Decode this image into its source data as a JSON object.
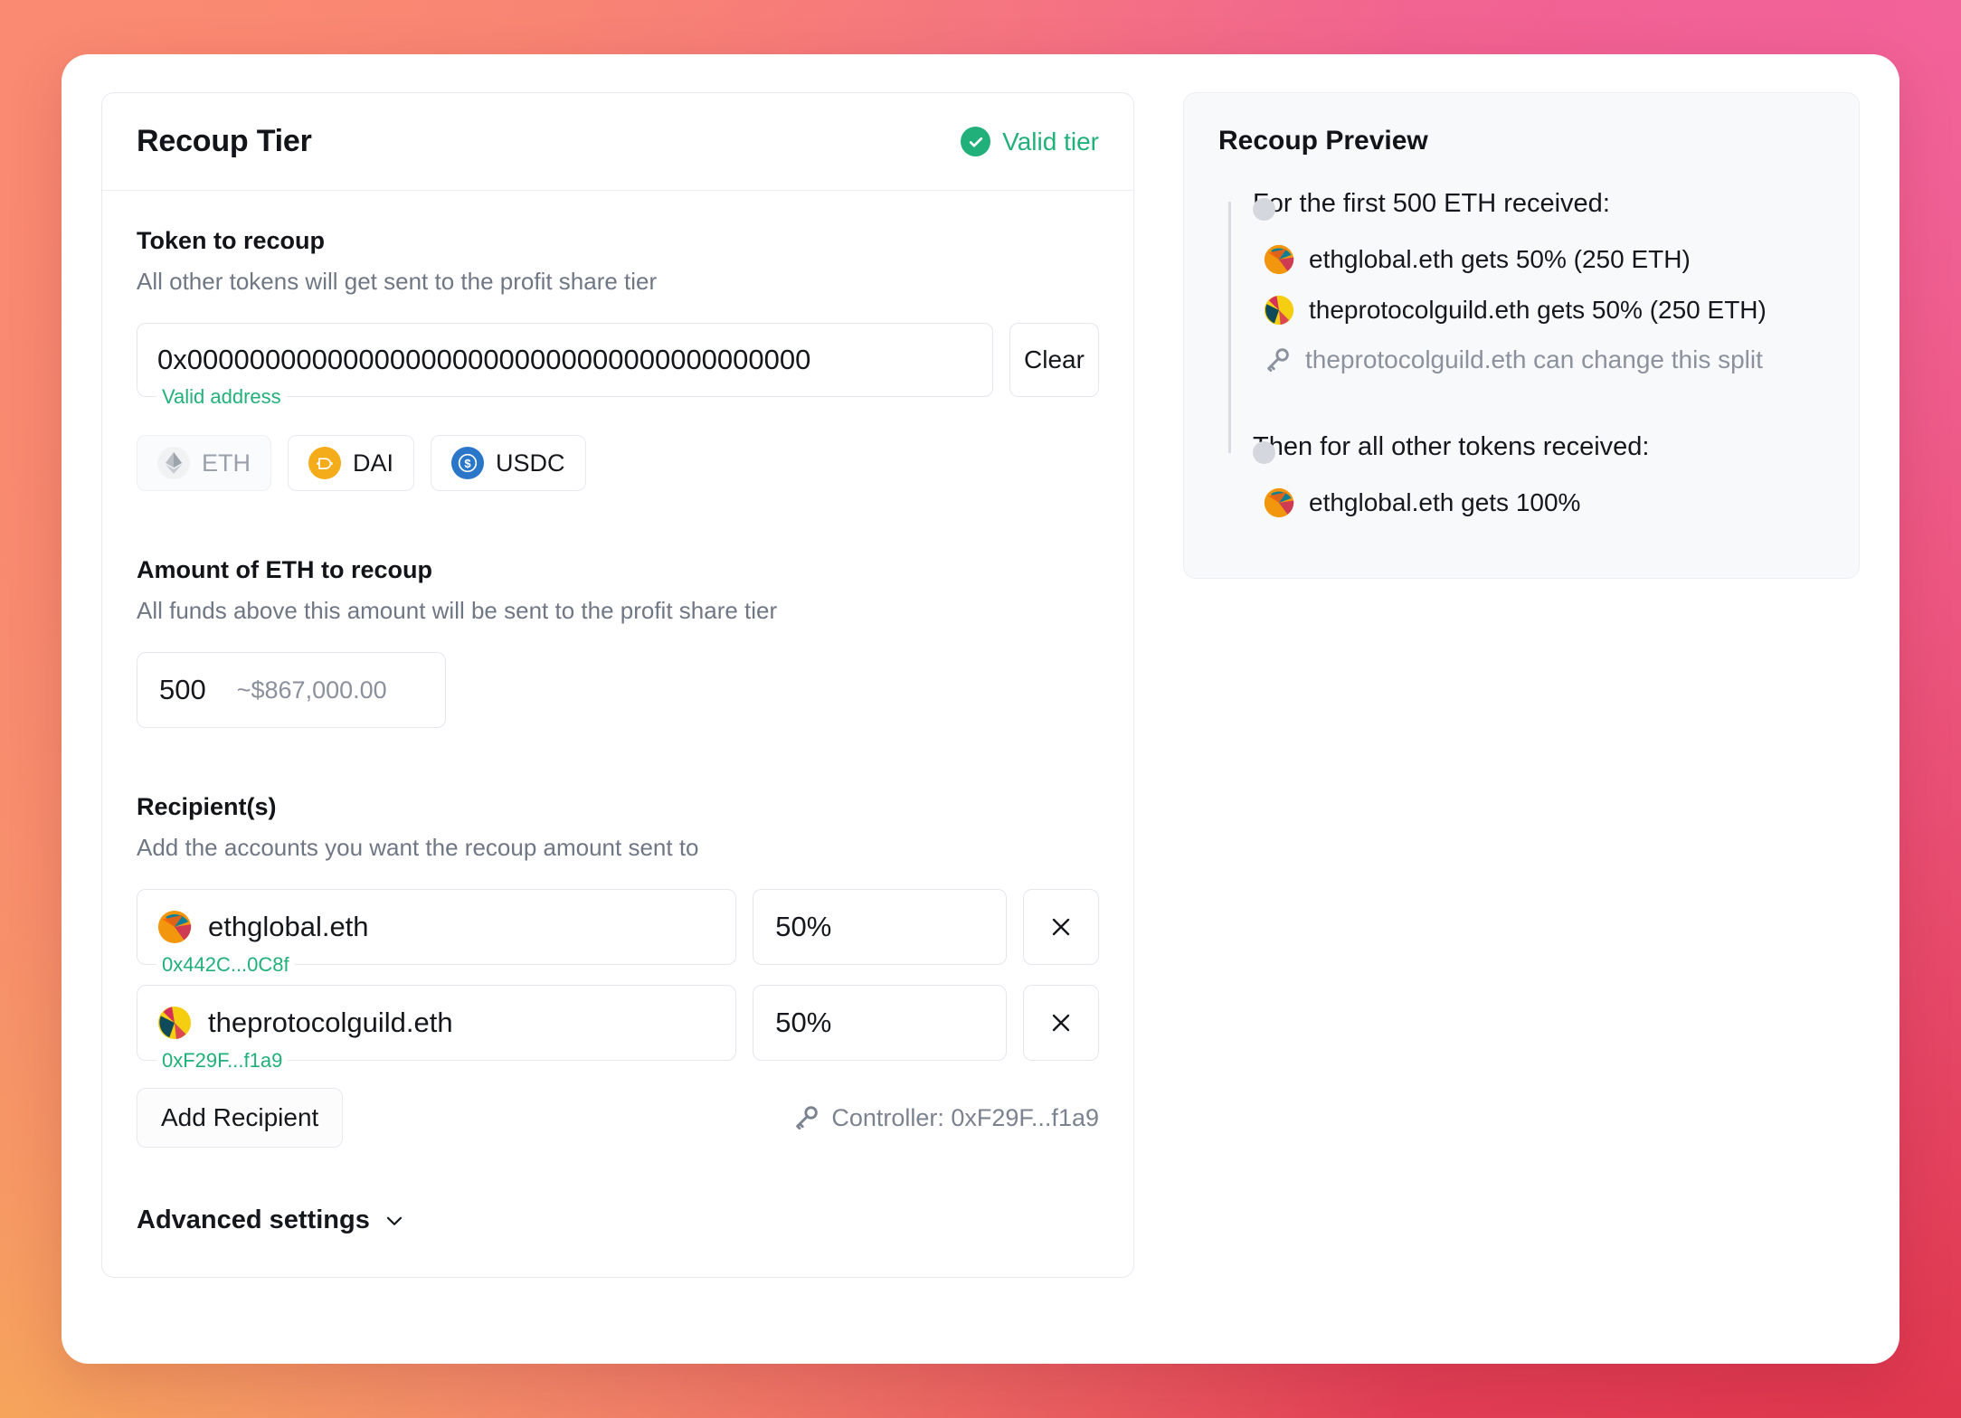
{
  "card": {
    "title": "Recoup Tier",
    "status": "Valid tier",
    "status_icon": "check-circle-icon",
    "status_color": "#21b07a"
  },
  "token": {
    "label": "Token to recoup",
    "help": "All other tokens will get sent to the profit share tier",
    "address_value": "0x0000000000000000000000000000000000000000",
    "address_validation": "Valid address",
    "clear_label": "Clear",
    "chips": [
      {
        "label": "ETH",
        "icon": "eth-token-icon",
        "selected": true
      },
      {
        "label": "DAI",
        "icon": "dai-token-icon",
        "selected": false
      },
      {
        "label": "USDC",
        "icon": "usdc-token-icon",
        "selected": false
      }
    ]
  },
  "amount": {
    "label": "Amount of ETH to recoup",
    "help": "All funds above this amount will be sent to the profit share tier",
    "value": "500",
    "usd": "~$867,000.00"
  },
  "recipients": {
    "label": "Recipient(s)",
    "help": "Add the accounts you want the recoup amount sent to",
    "rows": [
      {
        "name": "ethglobal.eth",
        "address": "0x442C...0C8f",
        "percent": "50%",
        "remove_label": "×",
        "avatar": "ethglobal-avatar"
      },
      {
        "name": "theprotocolguild.eth",
        "address": "0xF29F...f1a9",
        "percent": "50%",
        "remove_label": "×",
        "avatar": "protocolguild-avatar"
      }
    ],
    "add_label": "Add Recipient",
    "controller_label": "Controller: 0xF29F...f1a9",
    "controller_icon": "key-icon"
  },
  "advanced": {
    "label": "Advanced settings",
    "icon": "chevron-down-icon"
  },
  "preview": {
    "title": "Recoup Preview",
    "block1": {
      "heading": "For the first 500 ETH received:",
      "lines": [
        {
          "text": "ethglobal.eth gets 50% (250 ETH)",
          "icon": "ethglobal-avatar",
          "dim": false
        },
        {
          "text": "theprotocolguild.eth gets 50% (250 ETH)",
          "icon": "protocolguild-avatar",
          "dim": false
        },
        {
          "text": "theprotocolguild.eth can change this split",
          "icon": "key-icon",
          "dim": true
        }
      ]
    },
    "block2": {
      "heading": "Then for all other tokens received:",
      "lines": [
        {
          "text": "ethglobal.eth gets 100%",
          "icon": "ethglobal-avatar",
          "dim": false
        }
      ]
    }
  }
}
